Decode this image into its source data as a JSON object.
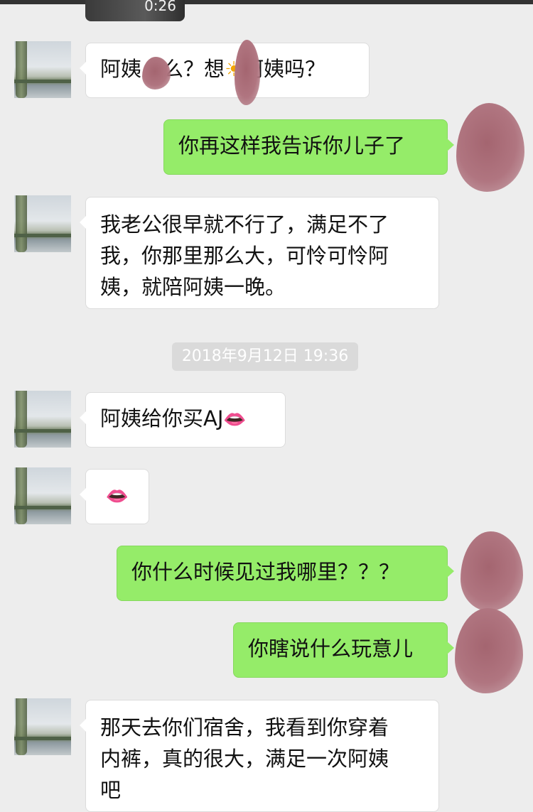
{
  "video": {
    "duration": "0:26"
  },
  "timestamp": "2018年9月12日 19:36",
  "messages": [
    {
      "side": "left",
      "parts": [
        "阿姨",
        "么？想",
        "☀",
        "阿姨吗？"
      ]
    },
    {
      "side": "right",
      "text": "你再这样我告诉你儿子了"
    },
    {
      "side": "left",
      "lines": [
        "我老公很早就不行了，满足不了",
        "我，你那里那么大，可怜可怜阿",
        "姨，就陪阿姨一晚。"
      ]
    },
    {
      "side": "left",
      "text": "阿姨给你买AJ",
      "emoji": "👄"
    },
    {
      "side": "left",
      "emoji": "👄"
    },
    {
      "side": "right",
      "text": "你什么时候见过我哪里？？？"
    },
    {
      "side": "right",
      "text": "你瞎说什么玩意儿"
    },
    {
      "side": "left",
      "lines": [
        "那天去你们宿舍，我看到你穿着",
        "内裤，真的很大，满足一次阿姨",
        "吧"
      ]
    }
  ]
}
